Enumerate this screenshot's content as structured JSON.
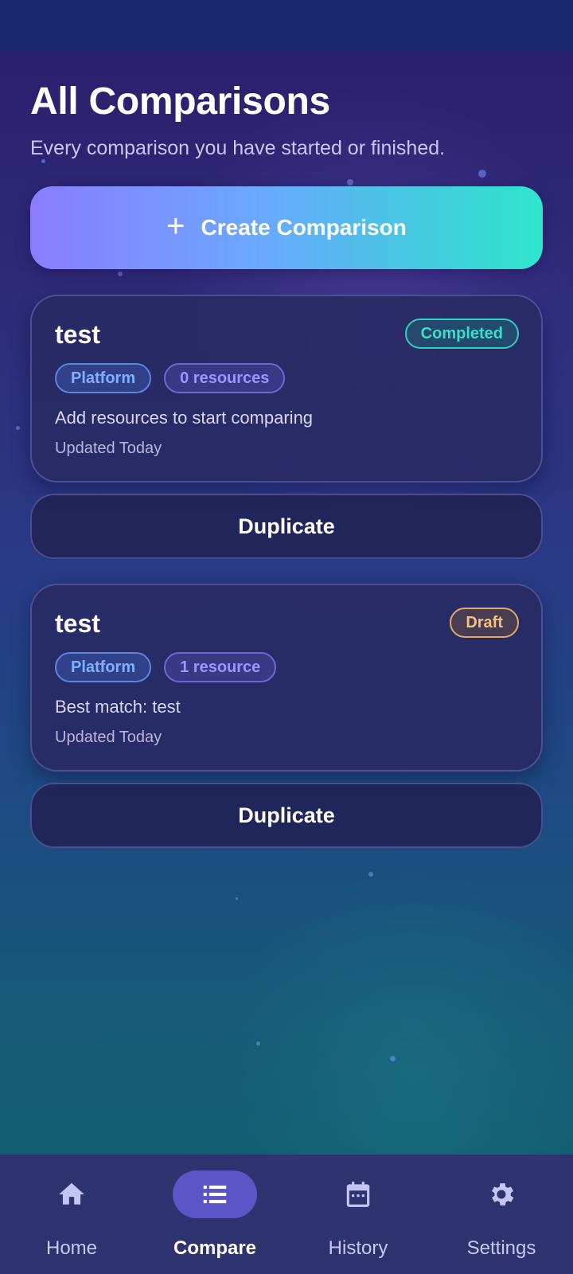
{
  "page": {
    "title": "All Comparisons",
    "subtitle": "Every comparison you have started or finished."
  },
  "create_button": {
    "label": "Create Comparison",
    "icon": "plus-icon"
  },
  "comparisons": [
    {
      "title": "test",
      "status": "Completed",
      "chips": [
        "Platform",
        "0 resources"
      ],
      "description": "Add resources to start comparing",
      "updated": "Updated Today",
      "action_label": "Duplicate"
    },
    {
      "title": "test",
      "status": "Draft",
      "chips": [
        "Platform",
        "1 resource"
      ],
      "description": "Best match: test",
      "updated": "Updated Today",
      "action_label": "Duplicate"
    }
  ],
  "nav": {
    "active": "Compare",
    "items": [
      {
        "label": "Home",
        "icon": "home-icon"
      },
      {
        "label": "Compare",
        "icon": "list-icon"
      },
      {
        "label": "History",
        "icon": "calendar-icon"
      },
      {
        "label": "Settings",
        "icon": "gear-icon"
      }
    ]
  },
  "colors": {
    "completed": "#38e0c8",
    "draft": "#f6c07e",
    "platform_chip": "#7fb0ff",
    "resources_chip": "#9d95ff",
    "nav_active": "#5b55c8"
  }
}
